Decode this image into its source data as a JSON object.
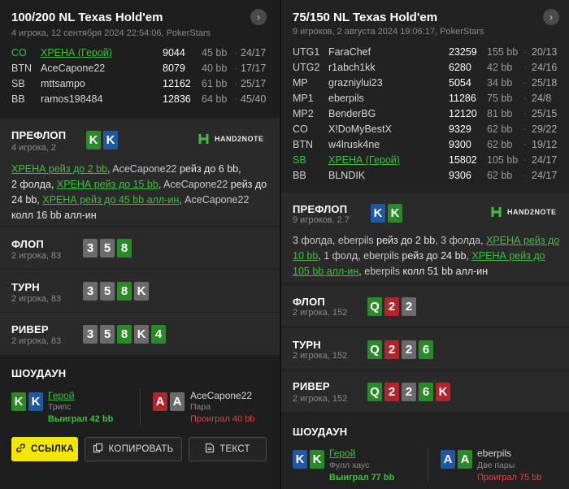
{
  "left": {
    "title": "100/200 NL Texas Hold'em",
    "subtitle": "4 игрока, 12 сентября 2024 22:54:06, PokerStars",
    "players": [
      {
        "pos": "CO",
        "name": "ХРЕНА (Герой)",
        "stack": "9044",
        "bb": "45 bb",
        "hud": "24/17",
        "hero": true
      },
      {
        "pos": "BTN",
        "name": "AceCapone22",
        "stack": "8079",
        "bb": "40 bb",
        "hud": "17/17",
        "hero": false
      },
      {
        "pos": "SB",
        "name": "mttsampo",
        "stack": "12162",
        "bb": "61 bb",
        "hud": "25/17",
        "hero": false
      },
      {
        "pos": "BB",
        "name": "ramos198484",
        "stack": "12836",
        "bb": "64 bb",
        "hud": "45/40",
        "hero": false
      }
    ],
    "preflop": {
      "label": "ПРЕФЛОП",
      "sub": "4 игрока, 2",
      "cards": [
        "K",
        "K"
      ],
      "brand": "HAND2NOTE",
      "a1": "ХРЕНА рейз до 2 bb",
      "a2": ", AceCapone22 ",
      "a3": "рейз до 6 bb,",
      "a4": "2 фолда, ",
      "a5": "ХРЕНА рейз до 15 bb",
      "a6": ", AceCapone22 ",
      "a7": "рейз до",
      "a8": "24 bb, ",
      "a9": "ХРЕНА рейз до 45 bb алл-ин",
      "a10": ", AceCapone22",
      "a11": "колл 16 bb алл-ин"
    },
    "flop": {
      "label": "ФЛОП",
      "sub": "2 игрока, 83",
      "cards": [
        "3",
        "5",
        "8"
      ]
    },
    "turn": {
      "label": "ТУРН",
      "sub": "2 игрока, 83",
      "cards": [
        "3",
        "5",
        "8",
        "K"
      ]
    },
    "river": {
      "label": "РИВЕР",
      "sub": "2 игрока, 83",
      "cards": [
        "3",
        "5",
        "8",
        "K",
        "4"
      ]
    },
    "showdown": {
      "label": "ШОУДАУН",
      "p1": {
        "cards": [
          "K",
          "K"
        ],
        "name": "Герой",
        "hand": "Трипс",
        "result": "Выиграл 42 bb"
      },
      "p2": {
        "cards": [
          "A",
          "A"
        ],
        "name": "AceCapone22",
        "hand": "Пара",
        "result": "Проиграл 40 bb"
      }
    },
    "buttons": {
      "link": "ССЫЛКА",
      "copy": "КОПИРОВАТЬ",
      "text": "ТЕКСТ"
    },
    "next_icon": "›"
  },
  "right": {
    "title": "75/150 NL Texas Hold'em",
    "subtitle": "9 игроков, 2 августа 2024 19:06:17, PokerStars",
    "players": [
      {
        "pos": "UTG1",
        "name": "FaraChef",
        "stack": "23259",
        "bb": "155 bb",
        "hud": "20/13",
        "hero": false
      },
      {
        "pos": "UTG2",
        "name": "r1abch1kk",
        "stack": "6280",
        "bb": "42 bb",
        "hud": "24/16",
        "hero": false
      },
      {
        "pos": "MP",
        "name": "grazniylui23",
        "stack": "5054",
        "bb": "34 bb",
        "hud": "25/18",
        "hero": false
      },
      {
        "pos": "MP1",
        "name": "eberpils",
        "stack": "11286",
        "bb": "75 bb",
        "hud": "24/8",
        "hero": false
      },
      {
        "pos": "MP2",
        "name": "BenderBG",
        "stack": "12120",
        "bb": "81 bb",
        "hud": "25/15",
        "hero": false
      },
      {
        "pos": "CO",
        "name": "X!DoMyBestX",
        "stack": "9329",
        "bb": "62 bb",
        "hud": "29/22",
        "hero": false
      },
      {
        "pos": "BTN",
        "name": "w4lrusk4ne",
        "stack": "9300",
        "bb": "62 bb",
        "hud": "19/12",
        "hero": false
      },
      {
        "pos": "SB",
        "name": "ХРЕНА (Герой)",
        "stack": "15802",
        "bb": "105 bb",
        "hud": "24/17",
        "hero": true
      },
      {
        "pos": "BB",
        "name": "BLNDIK",
        "stack": "9306",
        "bb": "62 bb",
        "hud": "24/17",
        "hero": false
      }
    ],
    "preflop": {
      "label": "ПРЕФЛОП",
      "sub": "9 игроков, 2.7",
      "cards": [
        "K",
        "K"
      ],
      "brand": "HAND2NOTE",
      "a1": "3 фолда, eberpils ",
      "a2": "рейз до 2 bb",
      "a3": ", 3 фолда, ",
      "a4": "ХРЕНА рейз до",
      "a5": "10 bb",
      "a6": ", 1 фолд, eberpils ",
      "a7": "рейз до 24 bb",
      "a8": ", ",
      "a9": "ХРЕНА рейз до",
      "a10": "105 bb алл-ин",
      "a11": ", eberpils ",
      "a12": "колл 51 bb алл-ин"
    },
    "flop": {
      "label": "ФЛОП",
      "sub": "2 игрока, 152",
      "cards": [
        "Q",
        "2",
        "2"
      ]
    },
    "turn": {
      "label": "ТУРН",
      "sub": "2 игрока, 152",
      "cards": [
        "Q",
        "2",
        "2",
        "6"
      ]
    },
    "river": {
      "label": "РИВЕР",
      "sub": "2 игрока, 152",
      "cards": [
        "Q",
        "2",
        "2",
        "6",
        "K"
      ]
    },
    "showdown": {
      "label": "ШОУДАУН",
      "p1": {
        "cards": [
          "K",
          "K"
        ],
        "name": "Герой",
        "hand": "Фулл хаус",
        "result": "Выиграл 77 bb"
      },
      "p2": {
        "cards": [
          "A",
          "A"
        ],
        "name": "eberpils",
        "hand": "Две пары",
        "result": "Проиграл 75 bb"
      }
    },
    "next_icon": "›"
  },
  "colors": {
    "hero": "#3cc13c",
    "lose": "#e24040",
    "link_button": "#f5e600"
  }
}
